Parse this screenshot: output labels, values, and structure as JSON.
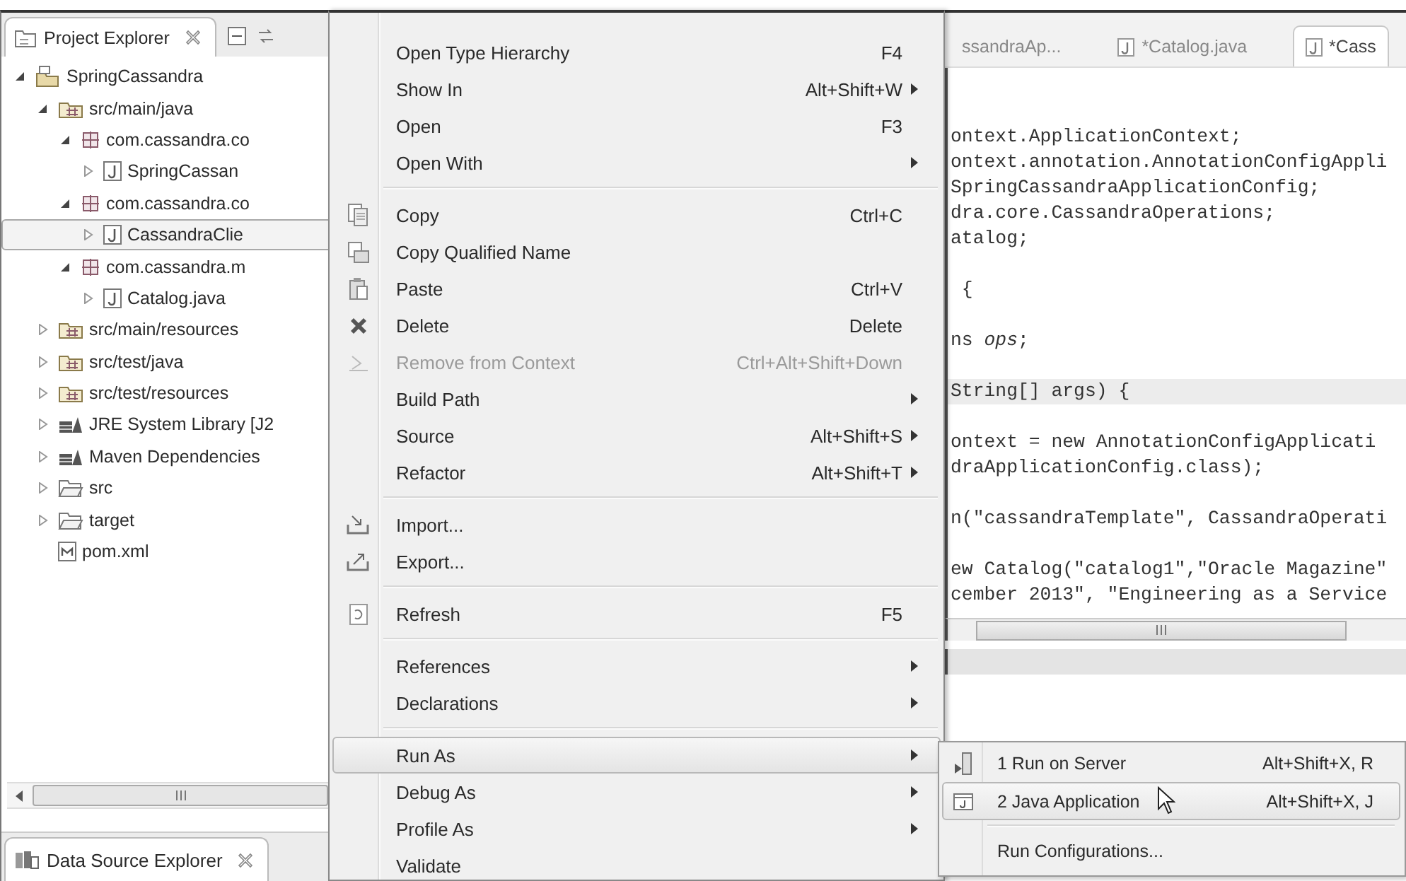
{
  "project_explorer": {
    "tab": {
      "label": "Project Explorer"
    },
    "tree": [
      {
        "label": "SpringCassandra",
        "kind": "project",
        "expanded": true,
        "selected": false,
        "children": [
          {
            "label": "src/main/java",
            "kind": "source-folder",
            "expanded": true,
            "selected": false,
            "children": [
              {
                "label": "com.cassandra.co",
                "kind": "package",
                "expanded": true,
                "selected": false,
                "children": [
                  {
                    "label": "SpringCassan",
                    "kind": "java-file",
                    "expanded": false,
                    "selected": false
                  }
                ]
              },
              {
                "label": "com.cassandra.co",
                "kind": "package",
                "expanded": true,
                "selected": false,
                "children": [
                  {
                    "label": "CassandraClie",
                    "kind": "java-file",
                    "expanded": false,
                    "selected": true
                  }
                ]
              },
              {
                "label": "com.cassandra.m",
                "kind": "package",
                "expanded": true,
                "selected": false,
                "children": [
                  {
                    "label": "Catalog.java",
                    "kind": "java-file",
                    "expanded": false,
                    "selected": false
                  }
                ]
              }
            ]
          },
          {
            "label": "src/main/resources",
            "kind": "source-folder",
            "expanded": false,
            "selected": false
          },
          {
            "label": "src/test/java",
            "kind": "source-folder",
            "expanded": false,
            "selected": false
          },
          {
            "label": "src/test/resources",
            "kind": "source-folder",
            "expanded": false,
            "selected": false
          },
          {
            "label": "JRE System Library [J2",
            "kind": "library",
            "expanded": false,
            "selected": false
          },
          {
            "label": "Maven Dependencies",
            "kind": "library",
            "expanded": false,
            "selected": false
          },
          {
            "label": "src",
            "kind": "folder",
            "expanded": false,
            "selected": false
          },
          {
            "label": "target",
            "kind": "folder",
            "expanded": false,
            "selected": false
          },
          {
            "label": "pom.xml",
            "kind": "xml-file",
            "selected": false
          }
        ]
      }
    ],
    "bottom_tab": {
      "label": "Data Source Explorer"
    }
  },
  "context_menu": {
    "items": [
      {
        "kind": "plain",
        "label": "Open Type Hierarchy",
        "shortcut": "F4",
        "submenu": false,
        "disabled": false,
        "selected": false
      },
      {
        "kind": "plain",
        "label": "Show In",
        "shortcut": "Alt+Shift+W",
        "submenu": true,
        "disabled": false,
        "selected": false
      },
      {
        "kind": "plain",
        "label": "Open",
        "shortcut": "F3",
        "submenu": false,
        "disabled": false,
        "selected": false
      },
      {
        "kind": "plain",
        "label": "Open With",
        "submenu": true,
        "disabled": false,
        "selected": false
      },
      {
        "kind": "separator"
      },
      {
        "kind": "copy",
        "label": "Copy",
        "shortcut": "Ctrl+C",
        "submenu": false,
        "disabled": false,
        "selected": false
      },
      {
        "kind": "copy-name",
        "label": "Copy Qualified Name",
        "submenu": false,
        "disabled": false,
        "selected": false
      },
      {
        "kind": "paste",
        "label": "Paste",
        "shortcut": "Ctrl+V",
        "submenu": false,
        "disabled": false,
        "selected": false
      },
      {
        "kind": "delete",
        "label": "Delete",
        "shortcut": "Delete",
        "submenu": false,
        "disabled": false,
        "selected": false
      },
      {
        "kind": "remove",
        "label": "Remove from Context",
        "shortcut": "Ctrl+Alt+Shift+Down",
        "submenu": false,
        "disabled": true,
        "selected": false
      },
      {
        "kind": "plain",
        "label": "Build Path",
        "submenu": true,
        "disabled": false,
        "selected": false
      },
      {
        "kind": "plain",
        "label": "Source",
        "shortcut": "Alt+Shift+S",
        "submenu": true,
        "disabled": false,
        "selected": false
      },
      {
        "kind": "plain",
        "label": "Refactor",
        "shortcut": "Alt+Shift+T",
        "submenu": true,
        "disabled": false,
        "selected": false
      },
      {
        "kind": "separator"
      },
      {
        "kind": "import",
        "label": "Import...",
        "submenu": false,
        "disabled": false,
        "selected": false
      },
      {
        "kind": "export",
        "label": "Export...",
        "submenu": false,
        "disabled": false,
        "selected": false
      },
      {
        "kind": "separator"
      },
      {
        "kind": "refresh",
        "label": "Refresh",
        "shortcut": "F5",
        "submenu": false,
        "disabled": false,
        "selected": false
      },
      {
        "kind": "separator"
      },
      {
        "kind": "plain",
        "label": "References",
        "submenu": true,
        "disabled": false,
        "selected": false
      },
      {
        "kind": "plain",
        "label": "Declarations",
        "submenu": true,
        "disabled": false,
        "selected": false
      },
      {
        "kind": "separator"
      },
      {
        "kind": "plain",
        "label": "Run As",
        "submenu": true,
        "disabled": false,
        "selected": true
      },
      {
        "kind": "plain",
        "label": "Debug As",
        "submenu": true,
        "disabled": false,
        "selected": false
      },
      {
        "kind": "plain",
        "label": "Profile As",
        "submenu": true,
        "disabled": false,
        "selected": false
      },
      {
        "kind": "plain",
        "label": "Validate",
        "submenu": false,
        "disabled": false,
        "selected": false
      }
    ]
  },
  "editor": {
    "tabs": [
      {
        "label": "ssandraAp...",
        "kind": "plain",
        "selected": false
      },
      {
        "label": "*Catalog.java",
        "kind": "java",
        "selected": false
      },
      {
        "label": "*Cass",
        "kind": "java",
        "selected": true
      }
    ],
    "code_blocks": [
      [
        {
          "text": "ontext.ApplicationContext;",
          "current": false
        },
        {
          "text": "ontext.annotation.AnnotationConfigAppli",
          "current": false
        },
        {
          "text": "SpringCassandraApplicationConfig;",
          "current": false
        },
        {
          "text": "dra.core.CassandraOperations;",
          "current": false
        },
        {
          "text": "atalog;",
          "current": false
        }
      ],
      [
        {
          "text": " {",
          "current": false
        }
      ],
      [
        {
          "text": "ns *ops*;",
          "current": false
        }
      ],
      [
        {
          "text": "String[] args) {",
          "current": true
        }
      ],
      [
        {
          "text": "ontext = new AnnotationConfigApplicati",
          "current": false
        },
        {
          "text": "draApplicationConfig.class);",
          "current": false
        }
      ],
      [
        {
          "text": "n(\"cassandraTemplate\", CassandraOperati",
          "current": false
        }
      ],
      [
        {
          "text": "ew Catalog(\"catalog1\",\"Oracle Magazine\"",
          "current": false
        },
        {
          "text": "cember 2013\", \"Engineering as a Service",
          "current": false
        }
      ]
    ]
  },
  "run_as_submenu": {
    "items": [
      {
        "kind": "server",
        "label": "1 Run on Server",
        "shortcut": "Alt+Shift+X, R",
        "selected": false
      },
      {
        "kind": "java-app",
        "label": "2 Java Application",
        "shortcut": "Alt+Shift+X, J",
        "selected": true
      },
      {
        "kind": "separator"
      },
      {
        "kind": "plain",
        "label": "Run Configurations...",
        "selected": false
      }
    ]
  }
}
